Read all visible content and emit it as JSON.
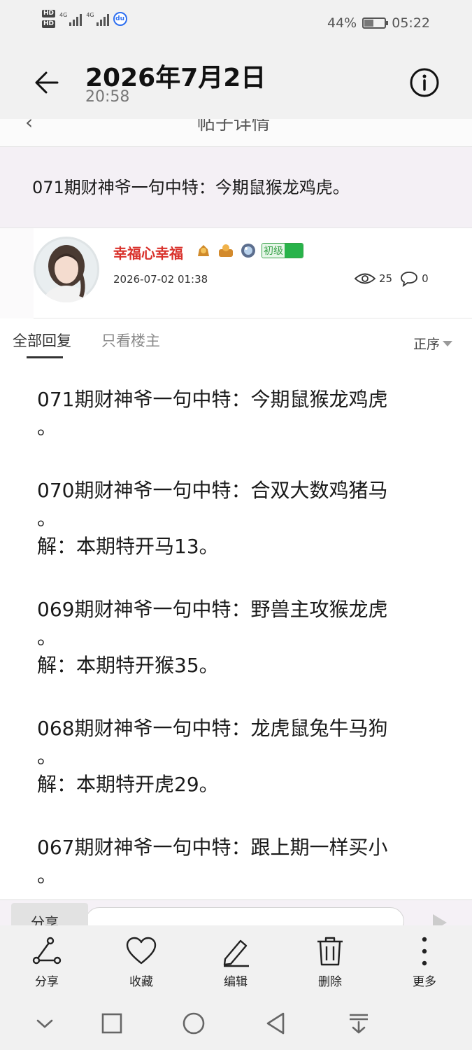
{
  "status_bar": {
    "battery_percent": "44%",
    "battery_level": 0.44,
    "clock": "05:22",
    "sim1_label": "HD",
    "sim2_label": "HD",
    "net1": "4G",
    "net2": "4G",
    "app_icon": "baidu-icon"
  },
  "header": {
    "title": "2026年7月2日",
    "subtitle": "20:58",
    "back_icon": "arrow-left-icon",
    "info_icon": "info-icon"
  },
  "underlying_page": {
    "back_glyph": "‹",
    "title": "帖子详情"
  },
  "post": {
    "title": "071期财神爷一句中特：今期鼠猴龙鸡虎。",
    "author": {
      "name": "幸福心幸福",
      "level": "初级",
      "date": "2026-07-02 01:38",
      "views": "25",
      "comments": "0"
    }
  },
  "tabs": {
    "all_replies": "全部回复",
    "owner_only": "只看楼主",
    "sort": "正序"
  },
  "content": {
    "entries": [
      {
        "line1": "071期财神爷一句中特：今期鼠猴龙鸡虎",
        "line2": "。",
        "line3": ""
      },
      {
        "line1": "070期财神爷一句中特：合双大数鸡猪马",
        "line2": "。",
        "line3": "解：本期特开马13。"
      },
      {
        "line1": "069期财神爷一句中特：野兽主攻猴龙虎",
        "line2": "。",
        "line3": "解：本期特开猴35。"
      },
      {
        "line1": "068期财神爷一句中特：龙虎鼠兔牛马狗",
        "line2": "。",
        "line3": "解：本期特开虎29。"
      },
      {
        "line1": "067期财神爷一句中特：跟上期一样买小",
        "line2": "。",
        "line3": ""
      }
    ]
  },
  "reply_bar": {
    "share_chip": "分享"
  },
  "actions": {
    "share": "分享",
    "favorite": "收藏",
    "edit": "编辑",
    "delete": "删除",
    "more": "更多"
  },
  "colors": {
    "username": "#d9312b",
    "level_green": "#28b34a",
    "banner_bg": "#f4f0f5",
    "bar_bg": "#f1f1f1"
  }
}
